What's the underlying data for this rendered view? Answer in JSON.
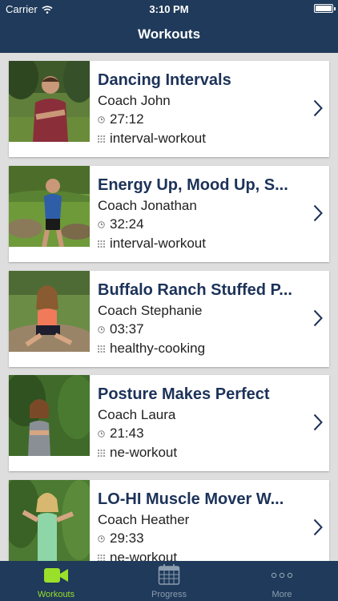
{
  "status": {
    "carrier": "Carrier",
    "time": "3:10 PM"
  },
  "nav": {
    "title": "Workouts"
  },
  "workouts": [
    {
      "title": "Dancing Intervals",
      "coach": "Coach John",
      "duration": "27:12",
      "category": "interval-workout"
    },
    {
      "title": "Energy Up, Mood Up, S...",
      "coach": "Coach Jonathan",
      "duration": "32:24",
      "category": "interval-workout"
    },
    {
      "title": "Buffalo Ranch Stuffed P...",
      "coach": "Coach Stephanie",
      "duration": "03:37",
      "category": "healthy-cooking"
    },
    {
      "title": "Posture Makes Perfect",
      "coach": "Coach Laura",
      "duration": "21:43",
      "category": "ne-workout"
    },
    {
      "title": "LO-HI Muscle Mover W...",
      "coach": "Coach Heather",
      "duration": "29:33",
      "category": "ne-workout"
    }
  ],
  "tabs": [
    {
      "label": "Workouts",
      "icon": "video-camera-icon",
      "active": true
    },
    {
      "label": "Progress",
      "icon": "calendar-icon",
      "active": false
    },
    {
      "label": "More",
      "icon": "more-dots-icon",
      "active": false
    }
  ],
  "colors": {
    "bar": "#1f3a5a",
    "accent": "#9adf2a",
    "title": "#1c3259",
    "chevron": "#1c3259"
  }
}
